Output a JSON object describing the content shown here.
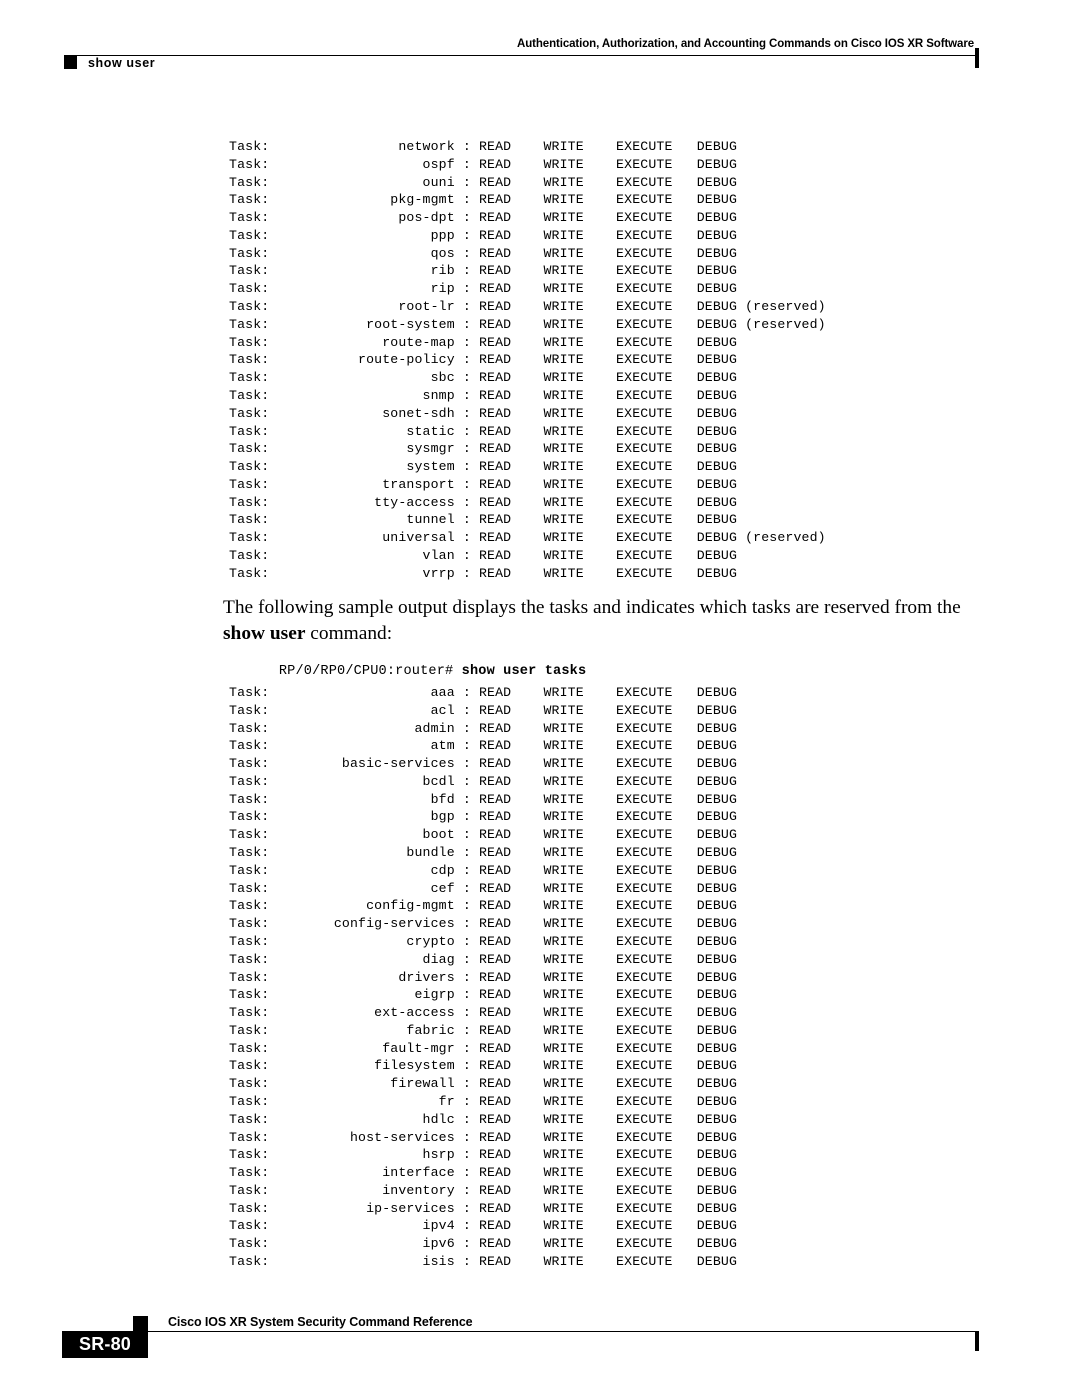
{
  "header": {
    "running_title": "Authentication, Authorization, and Accounting Commands on Cisco IOS XR Software",
    "running_head": "show user"
  },
  "body": {
    "paragraph_html": "The following sample output displays the tasks and indicates which tasks are reserved from the <b>show user</b> command:",
    "paragraph_text": "The following sample output displays the tasks and indicates which tasks are reserved from the show user command:",
    "prompt": "RP/0/RP0/CPU0:router# ",
    "command": "show user tasks",
    "permissions": [
      "READ",
      "WRITE",
      "EXECUTE",
      "DEBUG"
    ],
    "label_prefix": "Task:",
    "reserved_note": "(reserved)",
    "code_block_one": [
      {
        "task": "network",
        "reserved": false
      },
      {
        "task": "ospf",
        "reserved": false
      },
      {
        "task": "ouni",
        "reserved": false
      },
      {
        "task": "pkg-mgmt",
        "reserved": false
      },
      {
        "task": "pos-dpt",
        "reserved": false
      },
      {
        "task": "ppp",
        "reserved": false
      },
      {
        "task": "qos",
        "reserved": false
      },
      {
        "task": "rib",
        "reserved": false
      },
      {
        "task": "rip",
        "reserved": false
      },
      {
        "task": "root-lr",
        "reserved": true
      },
      {
        "task": "root-system",
        "reserved": true
      },
      {
        "task": "route-map",
        "reserved": false
      },
      {
        "task": "route-policy",
        "reserved": false
      },
      {
        "task": "sbc",
        "reserved": false
      },
      {
        "task": "snmp",
        "reserved": false
      },
      {
        "task": "sonet-sdh",
        "reserved": false
      },
      {
        "task": "static",
        "reserved": false
      },
      {
        "task": "sysmgr",
        "reserved": false
      },
      {
        "task": "system",
        "reserved": false
      },
      {
        "task": "transport",
        "reserved": false
      },
      {
        "task": "tty-access",
        "reserved": false
      },
      {
        "task": "tunnel",
        "reserved": false
      },
      {
        "task": "universal",
        "reserved": true
      },
      {
        "task": "vlan",
        "reserved": false
      },
      {
        "task": "vrrp",
        "reserved": false
      }
    ],
    "code_block_two": [
      {
        "task": "aaa",
        "reserved": false
      },
      {
        "task": "acl",
        "reserved": false
      },
      {
        "task": "admin",
        "reserved": false
      },
      {
        "task": "atm",
        "reserved": false
      },
      {
        "task": "basic-services",
        "reserved": false
      },
      {
        "task": "bcdl",
        "reserved": false
      },
      {
        "task": "bfd",
        "reserved": false
      },
      {
        "task": "bgp",
        "reserved": false
      },
      {
        "task": "boot",
        "reserved": false
      },
      {
        "task": "bundle",
        "reserved": false
      },
      {
        "task": "cdp",
        "reserved": false
      },
      {
        "task": "cef",
        "reserved": false
      },
      {
        "task": "config-mgmt",
        "reserved": false
      },
      {
        "task": "config-services",
        "reserved": false
      },
      {
        "task": "crypto",
        "reserved": false
      },
      {
        "task": "diag",
        "reserved": false
      },
      {
        "task": "drivers",
        "reserved": false
      },
      {
        "task": "eigrp",
        "reserved": false
      },
      {
        "task": "ext-access",
        "reserved": false
      },
      {
        "task": "fabric",
        "reserved": false
      },
      {
        "task": "fault-mgr",
        "reserved": false
      },
      {
        "task": "filesystem",
        "reserved": false
      },
      {
        "task": "firewall",
        "reserved": false
      },
      {
        "task": "fr",
        "reserved": false
      },
      {
        "task": "hdlc",
        "reserved": false
      },
      {
        "task": "host-services",
        "reserved": false
      },
      {
        "task": "hsrp",
        "reserved": false
      },
      {
        "task": "interface",
        "reserved": false
      },
      {
        "task": "inventory",
        "reserved": false
      },
      {
        "task": "ip-services",
        "reserved": false
      },
      {
        "task": "ipv4",
        "reserved": false
      },
      {
        "task": "ipv6",
        "reserved": false
      },
      {
        "task": "isis",
        "reserved": false
      }
    ]
  },
  "footer": {
    "document_title": "Cisco IOS XR System Security Command Reference",
    "page_number": "SR-80"
  },
  "colors": {
    "ink": "#000000",
    "paper": "#ffffff",
    "badge_text": "#ffffff"
  }
}
